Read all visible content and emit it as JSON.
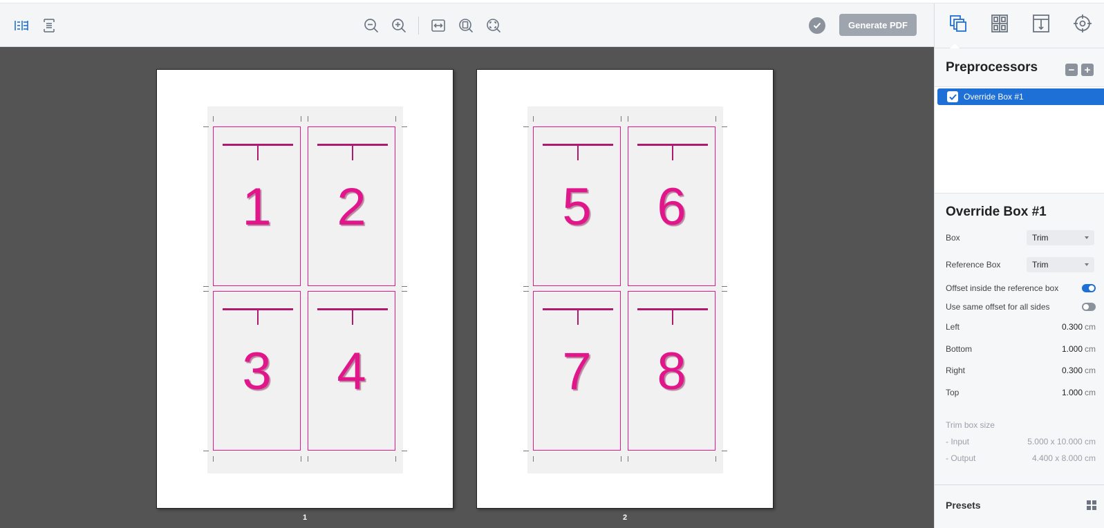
{
  "toolbar": {
    "icons": [
      "two-page-view-icon",
      "single-page-view-icon",
      "zoom-out-icon",
      "zoom-in-icon",
      "fit-width-icon",
      "fit-page-icon",
      "actual-size-icon",
      "status-check-icon"
    ],
    "generate_pdf_label": "Generate PDF"
  },
  "canvas": {
    "pages": [
      {
        "label": "1",
        "cards": [
          "1",
          "2",
          "3",
          "4"
        ]
      },
      {
        "label": "2",
        "cards": [
          "5",
          "6",
          "7",
          "8"
        ]
      }
    ],
    "colors": {
      "background": "#545454",
      "card_border": "#e0168a",
      "card_number": "#e0168a"
    }
  },
  "panel": {
    "tabs": [
      "preprocessors-tab-icon",
      "layout-tab-icon",
      "marks-tab-icon",
      "target-tab-icon"
    ],
    "preprocessors": {
      "title": "Preprocessors",
      "items": [
        {
          "label": "Override Box #1",
          "checked": true,
          "selected": true
        }
      ]
    },
    "override_box": {
      "title": "Override Box #1",
      "box_label": "Box",
      "box_value": "Trim",
      "reference_box_label": "Reference Box",
      "reference_box_value": "Trim",
      "offset_inside_label": "Offset inside the reference box",
      "offset_inside_on": true,
      "same_offset_label": "Use same offset for all sides",
      "same_offset_on": false,
      "sides": [
        {
          "label": "Left",
          "value": "0.300",
          "unit": "cm"
        },
        {
          "label": "Bottom",
          "value": "1.000",
          "unit": "cm"
        },
        {
          "label": "Right",
          "value": "0.300",
          "unit": "cm"
        },
        {
          "label": "Top",
          "value": "1.000",
          "unit": "cm"
        }
      ],
      "trim_box_size_label": "Trim box size",
      "input_label": "- Input",
      "input_value": "5.000 x 10.000 cm",
      "output_label": "- Output",
      "output_value": "4.400 x 8.000 cm"
    },
    "presets_label": "Presets",
    "accent": "#1e6fd6"
  }
}
